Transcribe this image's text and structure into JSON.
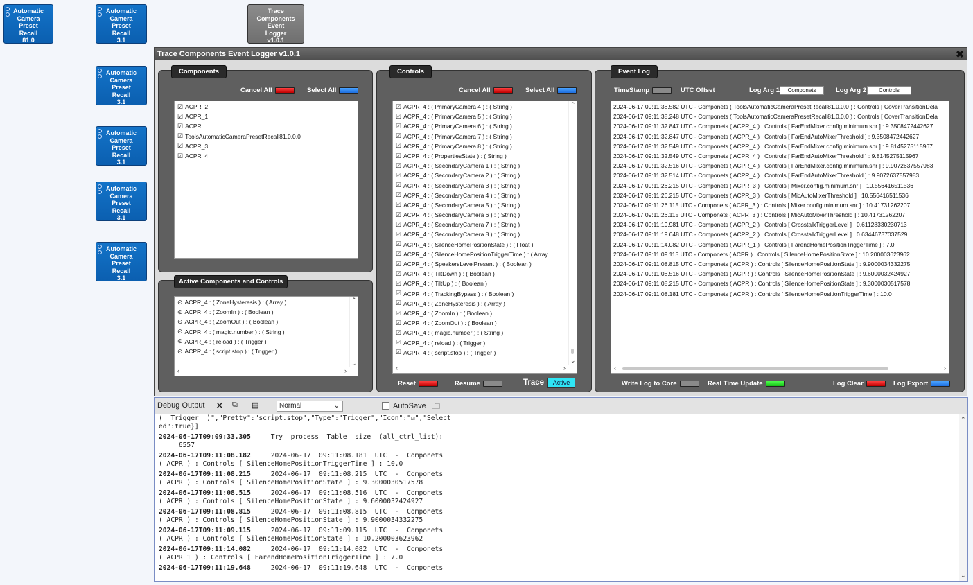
{
  "canvas_blocks": [
    {
      "lines": [
        "Automatic",
        "Camera",
        "Preset",
        "Recall",
        "81.0"
      ],
      "style": "blue"
    },
    {
      "lines": [
        "Automatic",
        "Camera",
        "Preset",
        "Recall",
        "3.1"
      ],
      "style": "blue"
    },
    {
      "lines": [
        "Trace",
        "Components",
        "Event",
        "Logger",
        "v1.0.1"
      ],
      "style": "gray"
    },
    {
      "lines": [
        "Automatic",
        "Camera",
        "Preset",
        "Recall",
        "3.1"
      ],
      "style": "blue"
    },
    {
      "lines": [
        "Automatic",
        "Camera",
        "Preset",
        "Recall",
        "3.1"
      ],
      "style": "blue"
    },
    {
      "lines": [
        "Automatic",
        "Camera",
        "Preset",
        "Recall",
        "3.1"
      ],
      "style": "blue"
    },
    {
      "lines": [
        "Automatic",
        "Camera",
        "Preset",
        "Recall",
        "3.1"
      ],
      "style": "blue"
    }
  ],
  "window": {
    "title": "Trace Components Event Logger v1.0.1",
    "close_icon": "✖"
  },
  "components_panel": {
    "tab": "Components",
    "cancel_all": "Cancel All",
    "select_all": "Select All",
    "items": [
      "ACPR_2",
      "ACPR_1",
      "ACPR",
      "ToolsAutomaticCameraPresetRecall81.0.0.0",
      "ACPR_3",
      "ACPR_4"
    ]
  },
  "active_panel": {
    "tab": "Active Components and Controls",
    "items": [
      "ACPR_4 : ( ZoneHysteresis ) : ( Array )",
      "ACPR_4 : ( ZoomIn ) : ( Boolean )",
      "ACPR_4 : ( ZoomOut ) : ( Boolean )",
      "ACPR_4 : ( magic.number ) : ( String )",
      "ACPR_4 : ( reload ) : ( Trigger )",
      "ACPR_4 : ( script.stop ) : ( Trigger )"
    ]
  },
  "controls_panel": {
    "tab": "Controls",
    "cancel_all": "Cancel All",
    "select_all": "Select All",
    "items": [
      "ACPR_4 : ( PrimaryCamera 4 ) : ( String )",
      "ACPR_4 : ( PrimaryCamera 5 ) : ( String )",
      "ACPR_4 : ( PrimaryCamera 6 ) : ( String )",
      "ACPR_4 : ( PrimaryCamera 7 ) : ( String )",
      "ACPR_4 : ( PrimaryCamera 8 ) : ( String )",
      "ACPR_4 : ( PropertiesState ) : ( String )",
      "ACPR_4 : ( SecondaryCamera 1 ) : ( String )",
      "ACPR_4 : ( SecondaryCamera 2 ) : ( String )",
      "ACPR_4 : ( SecondaryCamera 3 ) : ( String )",
      "ACPR_4 : ( SecondaryCamera 4 ) : ( String )",
      "ACPR_4 : ( SecondaryCamera 5 ) : ( String )",
      "ACPR_4 : ( SecondaryCamera 6 ) : ( String )",
      "ACPR_4 : ( SecondaryCamera 7 ) : ( String )",
      "ACPR_4 : ( SecondaryCamera 8 ) : ( String )",
      "ACPR_4 : ( SilenceHomePositionState ) : ( Float )",
      "ACPR_4 : ( SilenceHomePositionTriggerTime ) : ( Array",
      "ACPR_4 : ( SpeakersLevelPresent ) : ( Boolean )",
      "ACPR_4 : ( TiltDown ) : ( Boolean )",
      "ACPR_4 : ( TiltUp ) : ( Boolean )",
      "ACPR_4 : ( TrackingBypass ) : ( Boolean )",
      "ACPR_4 : ( ZoneHysteresis ) : ( Array )",
      "ACPR_4 : ( ZoomIn ) : ( Boolean )",
      "ACPR_4 : ( ZoomOut ) : ( Boolean )",
      "ACPR_4 : ( magic.number ) : ( String )",
      "ACPR_4 : ( reload ) : ( Trigger )",
      "ACPR_4 : ( script.stop ) : ( Trigger )"
    ],
    "reset": "Reset",
    "resume": "Resume",
    "trace": "Trace",
    "active": "Active"
  },
  "event_log_panel": {
    "tab": "Event Log",
    "timestamp": "TimeStamp",
    "utc_offset": "UTC Offset",
    "log_arg1_label": "Log Arg 1",
    "log_arg1_value": "Componets",
    "log_arg2_label": "Log Arg 2",
    "log_arg2_value": "Controls",
    "entries": [
      "2024-06-17 09:11:38.582 UTC - Componets ( ToolsAutomaticCameraPresetRecall81.0.0.0 ) : Controls [ CoverTransitionDela",
      "2024-06-17 09:11:38.248 UTC - Componets ( ToolsAutomaticCameraPresetRecall81.0.0.0 ) : Controls [ CoverTransitionDela",
      "2024-06-17 09:11:32.847 UTC - Componets ( ACPR_4 ) : Controls [ FarEndMixer.config.minimum.snr ] : 9.3508472442627",
      "2024-06-17 09:11:32.847 UTC - Componets ( ACPR_4 ) : Controls [ FarEndAutoMixerThreshold ] : 9.3508472442627",
      "2024-06-17 09:11:32.549 UTC - Componets ( ACPR_4 ) : Controls [ FarEndMixer.config.minimum.snr ] : 9.8145275115967",
      "2024-06-17 09:11:32.549 UTC - Componets ( ACPR_4 ) : Controls [ FarEndAutoMixerThreshold ] : 9.8145275115967",
      "2024-06-17 09:11:32.516 UTC - Componets ( ACPR_4 ) : Controls [ FarEndMixer.config.minimum.snr ] : 9.9072637557983",
      "2024-06-17 09:11:32.514 UTC - Componets ( ACPR_4 ) : Controls [ FarEndAutoMixerThreshold ] : 9.9072637557983",
      "2024-06-17 09:11:26.215 UTC - Componets ( ACPR_3 ) : Controls [ Mixer.config.minimum.snr ] : 10.556416511536",
      "2024-06-17 09:11:26.215 UTC - Componets ( ACPR_3 ) : Controls [ MicAutoMixerThreshold ] : 10.556416511536",
      "2024-06-17 09:11:26.115 UTC - Componets ( ACPR_3 ) : Controls [ Mixer.config.minimum.snr ] : 10.41731262207",
      "2024-06-17 09:11:26.115 UTC - Componets ( ACPR_3 ) : Controls [ MicAutoMixerThreshold ] : 10.41731262207",
      "2024-06-17 09:11:19.981 UTC - Componets ( ACPR_2 ) : Controls [ CrosstalkTriggerLevel ] : 0.61128330230713",
      "2024-06-17 09:11:19.648 UTC - Componets ( ACPR_2 ) : Controls [ CrosstalkTriggerLevel ] : 0.63446737037529",
      "2024-06-17 09:11:14.082 UTC - Componets ( ACPR_1 ) : Controls [ FarendHomePositionTriggerTime ] : 7.0",
      "2024-06-17 09:11:09.115 UTC - Componets ( ACPR ) : Controls [ SilenceHomePositionState ] : 10.200003623962",
      "2024-06-17 09:11:08.815 UTC - Componets ( ACPR ) : Controls [ SilenceHomePositionState ] : 9.9000034332275",
      "2024-06-17 09:11:08.516 UTC - Componets ( ACPR ) : Controls [ SilenceHomePositionState ] : 9.6000032424927",
      "2024-06-17 09:11:08.215 UTC - Componets ( ACPR ) : Controls [ SilenceHomePositionState ] : 9.3000030517578",
      "2024-06-17 09:11:08.181 UTC - Componets ( ACPR ) : Controls [ SilenceHomePositionTriggerTime ] : 10.0"
    ],
    "write_log": "Write Log to Core",
    "realtime": "Real Time Update",
    "log_clear": "Log Clear",
    "log_export": "Log Export"
  },
  "debug": {
    "title": "Debug Output",
    "level": "Normal",
    "autosave": "AutoSave",
    "entries": [
      {
        "lines": [
          "(  Trigger  )\",\"Pretty\":\"script.stop\",\"Type\":\"Trigger\",\"Icon\":\"☑\",\"Select",
          "ed\":true}]"
        ]
      },
      {
        "ts": "2024-06-17T09:09:33.305",
        "lines": [
          "     Try  process  Table  size  (all_ctrl_list):",
          "     6557"
        ]
      },
      {
        "ts": "2024-06-17T09:11:08.182",
        "lines": [
          "     2024-06-17  09:11:08.181  UTC  -  Componets",
          "( ACPR ) : Controls [ SilenceHomePositionTriggerTime ] : 10.0"
        ]
      },
      {
        "ts": "2024-06-17T09:11:08.215",
        "lines": [
          "     2024-06-17  09:11:08.215  UTC  -  Componets",
          "( ACPR ) : Controls [ SilenceHomePositionState ] : 9.3000030517578"
        ]
      },
      {
        "ts": "2024-06-17T09:11:08.515",
        "lines": [
          "     2024-06-17  09:11:08.516  UTC  -  Componets",
          "( ACPR ) : Controls [ SilenceHomePositionState ] : 9.6000032424927"
        ]
      },
      {
        "ts": "2024-06-17T09:11:08.815",
        "lines": [
          "     2024-06-17  09:11:08.815  UTC  -  Componets",
          "( ACPR ) : Controls [ SilenceHomePositionState ] : 9.9000034332275"
        ]
      },
      {
        "ts": "2024-06-17T09:11:09.115",
        "lines": [
          "     2024-06-17  09:11:09.115  UTC  -  Componets",
          "( ACPR ) : Controls [ SilenceHomePositionState ] : 10.200003623962"
        ]
      },
      {
        "ts": "2024-06-17T09:11:14.082",
        "lines": [
          "     2024-06-17  09:11:14.082  UTC  -  Componets",
          "( ACPR_1 ) : Controls [ FarendHomePositionTriggerTime ] : 7.0"
        ]
      },
      {
        "ts": "2024-06-17T09:11:19.648",
        "lines": [
          "     2024-06-17  09:11:19.648  UTC  -  Componets"
        ]
      }
    ]
  }
}
